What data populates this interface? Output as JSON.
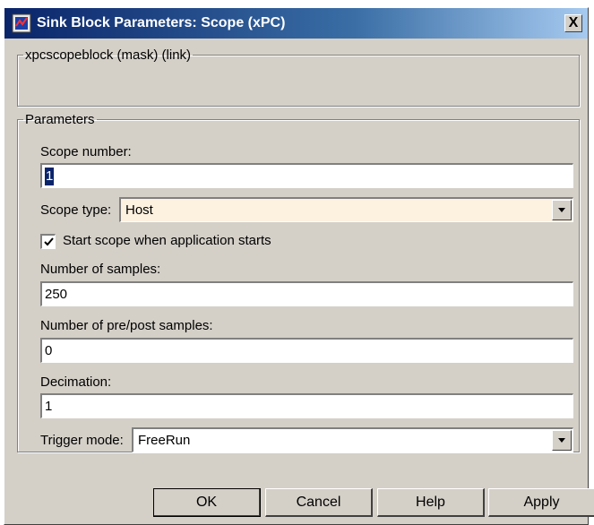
{
  "window": {
    "title": "Sink Block Parameters: Scope (xPC)",
    "icon": "simulink-block-icon",
    "close_label": "X"
  },
  "mask_group": {
    "legend": "xpcscopeblock (mask) (link)"
  },
  "parameters": {
    "legend": "Parameters",
    "scope_number": {
      "label": "Scope number:",
      "value": "1"
    },
    "scope_type": {
      "label": "Scope type:",
      "value": "Host"
    },
    "start_scope": {
      "label": "Start scope when application starts",
      "checked": true
    },
    "num_samples": {
      "label": "Number of samples:",
      "value": "250"
    },
    "pre_post": {
      "label": "Number of pre/post samples:",
      "value": "0"
    },
    "decimation": {
      "label": "Decimation:",
      "value": "1"
    },
    "trigger_mode": {
      "label": "Trigger mode:",
      "value": "FreeRun"
    }
  },
  "buttons": {
    "ok": "OK",
    "cancel": "Cancel",
    "help": "Help",
    "apply": "Apply"
  }
}
